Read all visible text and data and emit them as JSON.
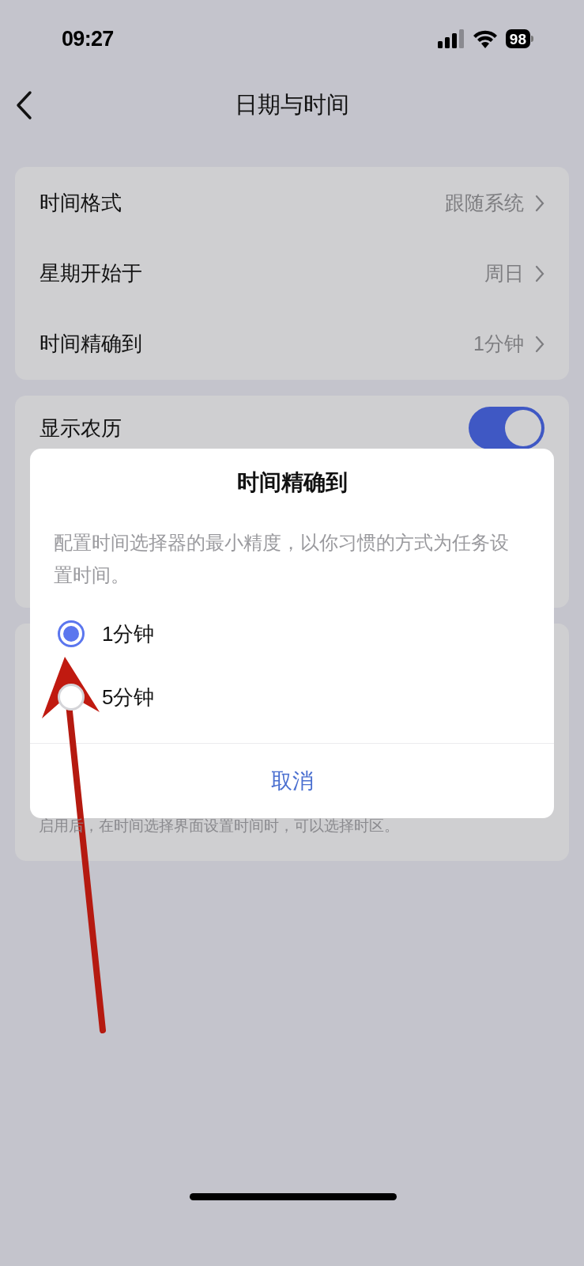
{
  "status_bar": {
    "time": "09:27",
    "battery": "98"
  },
  "nav": {
    "title": "日期与时间"
  },
  "settings": [
    {
      "label": "时间格式",
      "value": "跟随系统"
    },
    {
      "label": "星期开始于",
      "value": "周日"
    },
    {
      "label": "时间精确到",
      "value": "1分钟"
    }
  ],
  "lunar": {
    "label": "显示农历",
    "on": true
  },
  "timezone_caption": "启用后，在时间选择界面设置时间时，可以选择时区。",
  "dialog": {
    "title": "时间精确到",
    "description": "配置时间选择器的最小精度，以你习惯的方式为任务设置时间。",
    "options": [
      {
        "label": "1分钟",
        "selected": true
      },
      {
        "label": "5分钟",
        "selected": false
      }
    ],
    "cancel": "取消"
  }
}
